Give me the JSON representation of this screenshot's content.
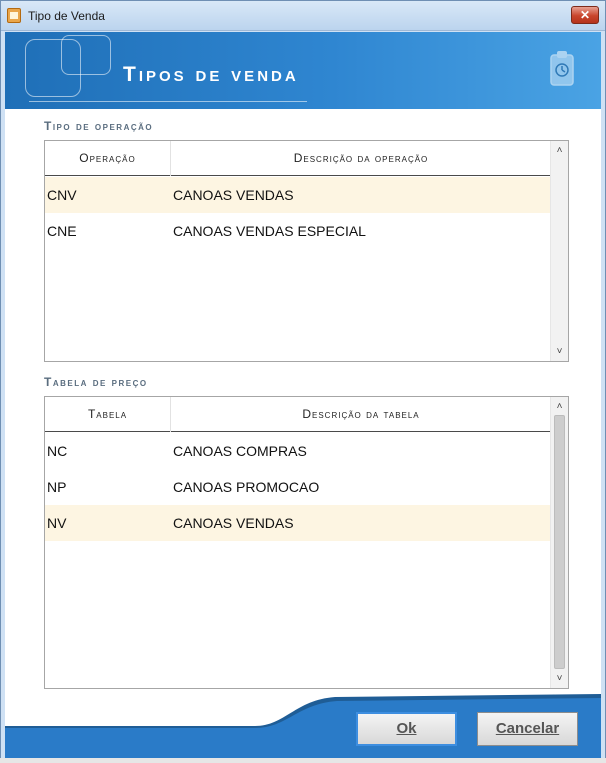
{
  "window": {
    "title": "Tipo de Venda",
    "close_label": "✕"
  },
  "banner": {
    "title": "Tipos de venda"
  },
  "operacao": {
    "section_label": "Tipo de operação",
    "columns": [
      "Operação",
      "Descrição da operação"
    ],
    "rows": [
      {
        "code": "CNV",
        "desc": "CANOAS VENDAS",
        "selected": true
      },
      {
        "code": "CNE",
        "desc": "CANOAS VENDAS ESPECIAL",
        "selected": false
      }
    ]
  },
  "tabela": {
    "section_label": "Tabela de preço",
    "columns": [
      "Tabela",
      "Descrição da tabela"
    ],
    "rows": [
      {
        "code": "NC",
        "desc": "CANOAS COMPRAS",
        "selected": false
      },
      {
        "code": "NP",
        "desc": "CANOAS PROMOCAO",
        "selected": false
      },
      {
        "code": "NV",
        "desc": "CANOAS VENDAS",
        "selected": true
      }
    ]
  },
  "buttons": {
    "ok": "Ok",
    "cancel": "Cancelar"
  },
  "scroll": {
    "up": "˄",
    "down": "˅"
  },
  "colors": {
    "banner": "#2f86d1",
    "selected_row": "#fdf5e2",
    "default_button_border": "#3d8ee0"
  },
  "icons": {
    "app": "app-icon",
    "banner_logo": "overlapping-squares-logo",
    "clipboard": "clipboard-icon"
  }
}
